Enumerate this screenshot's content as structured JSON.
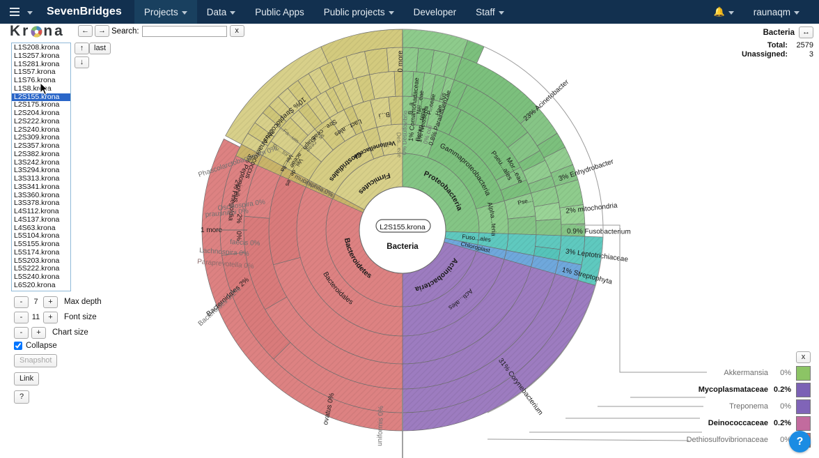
{
  "navbar": {
    "brand": "SevenBridges",
    "menu_icon": "hamburger-icon",
    "items": [
      {
        "label": "Projects",
        "caret": true,
        "active": true
      },
      {
        "label": "Data",
        "caret": true,
        "active": false
      },
      {
        "label": "Public Apps",
        "caret": false,
        "active": false
      },
      {
        "label": "Public projects",
        "caret": true,
        "active": false
      },
      {
        "label": "Developer",
        "caret": false,
        "active": false
      },
      {
        "label": "Staff",
        "caret": true,
        "active": false
      }
    ],
    "notifications_icon": "bell-icon",
    "user": "raunaqm"
  },
  "krona": {
    "logo_text_before": "Kr",
    "logo_text_after": "na",
    "back_label": "←",
    "forward_label": "→",
    "search_label": "Search:",
    "search_value": "",
    "search_placeholder": "",
    "search_clear_label": "x",
    "up_label": "↑",
    "down_label": "↓",
    "last_label": "last"
  },
  "file_list": {
    "selected": "L2S155.krona",
    "items": [
      "L1S208.krona",
      "L1S257.krona",
      "L1S281.krona",
      "L1S57.krona",
      "L1S76.krona",
      "L1S8.krona",
      "L2S155.krona",
      "L2S175.krona",
      "L2S204.krona",
      "L2S222.krona",
      "L2S240.krona",
      "L2S309.krona",
      "L2S357.krona",
      "L2S382.krona",
      "L3S242.krona",
      "L3S294.krona",
      "L3S313.krona",
      "L3S341.krona",
      "L3S360.krona",
      "L3S378.krona",
      "L4S112.krona",
      "L4S137.krona",
      "L4S63.krona",
      "L5S104.krona",
      "L5S155.krona",
      "L5S174.krona",
      "L5S203.krona",
      "L5S222.krona",
      "L5S240.krona",
      "L6S20.krona"
    ]
  },
  "controls": {
    "minus": "-",
    "plus": "+",
    "max_depth_value": "7",
    "max_depth_label": "Max depth",
    "font_size_value": "11",
    "font_size_label": "Font size",
    "chart_size_label": "Chart size",
    "collapse_label": "Collapse",
    "collapse_checked": true,
    "snapshot_label": "Snapshot",
    "link_label": "Link",
    "help_label": "?"
  },
  "info": {
    "title": "Bacteria",
    "resize_icon": "resize-horizontal-icon",
    "total_label": "Total:",
    "total_value": "2579",
    "unassigned_label": "Unassigned:",
    "unassigned_value": "3"
  },
  "key": {
    "close_label": "x",
    "items": [
      {
        "label": "Akkermansia",
        "pct": "0%",
        "color": "#8cc465",
        "bold": false
      },
      {
        "label": "Mycoplasmataceae",
        "pct": "0.2%",
        "color": "#7b61b5",
        "bold": true
      },
      {
        "label": "Treponema",
        "pct": "0%",
        "color": "#8064b8",
        "bold": false
      },
      {
        "label": "Deinococcaceae",
        "pct": "0.2%",
        "color": "#c26b9e",
        "bold": true
      },
      {
        "label": "Dethiosulfovibrionaceae",
        "pct": "0%",
        "color": "#db6f6f",
        "bold": false
      }
    ]
  },
  "help_bubble": {
    "label": "?"
  },
  "chart_data": {
    "type": "pie",
    "title": "Bacteria",
    "center_file_label": "L2S155.krona",
    "center_label": "Bacteria",
    "total": 2579,
    "unassigned": 3,
    "colors": {
      "firmicutes": "#d8d08a",
      "proteobacteria": "#84c585",
      "bacteroidetes": "#dd8282",
      "actinobacteria": "#9d7cc0",
      "fusobacteria": "#5fc9bf",
      "cyanobacteria": "#6fa8dc",
      "verrucomicrobia": "#c9b46a",
      "background": "#ffffff",
      "stroke": "#5b5b5b"
    },
    "slices": [
      {
        "label": "Firmicutes",
        "pct": "",
        "ring": 1,
        "color": "#d8d08a"
      },
      {
        "label": "Proteobacteria",
        "pct": "",
        "ring": 1,
        "color": "#84c585"
      },
      {
        "label": "Bacteroidetes",
        "pct": "",
        "ring": 1,
        "color": "#dd8282"
      },
      {
        "label": "Actinobacteria",
        "pct": "",
        "ring": 1,
        "color": "#9d7cc0"
      },
      {
        "label": "Clostridiales",
        "pct": "",
        "ring": 2,
        "color": "#d6cd84"
      },
      {
        "label": "Bacteroidales",
        "pct": "",
        "ring": 2,
        "color": "#dd8282"
      },
      {
        "label": "Gammaproteobacteria",
        "pct": "",
        "ring": 2,
        "color": "#7cc07d"
      },
      {
        "label": "Acti...ales",
        "pct": "",
        "ring": 2,
        "color": "#9d7cc0"
      }
    ],
    "annotations": [
      {
        "text": "0 more",
        "pct": ""
      },
      {
        "text": "1 more",
        "pct": ""
      },
      {
        "text": "Streptococcus",
        "pct": "10%"
      },
      {
        "text": "Anaerococcus",
        "pct": "3%"
      },
      {
        "text": "Peptoniphilus",
        "pct": "3%"
      },
      {
        "text": "Finegoldia",
        "pct": "2%"
      },
      {
        "text": "Phascolarctobacterium",
        "pct": "0%"
      },
      {
        "text": "Oscillospira",
        "pct": "0%"
      },
      {
        "text": "prausnitzii",
        "pct": "0%"
      },
      {
        "text": "faecis",
        "pct": "0%"
      },
      {
        "text": "Lachnospira",
        "pct": "0%"
      },
      {
        "text": "Paraprevotella",
        "pct": "0%"
      },
      {
        "text": "Bacteroidales",
        "pct": "2%"
      },
      {
        "text": "Bacteroides",
        "pct": "0.2%"
      },
      {
        "text": "ovatus",
        "pct": "0%"
      },
      {
        "text": "uniformis",
        "pct": "0%"
      },
      {
        "text": "Corynebacterium",
        "pct": "31%"
      },
      {
        "text": "Streptophyta",
        "pct": "1%"
      },
      {
        "text": "Leptotrichiaceae",
        "pct": "3%"
      },
      {
        "text": "Fusobacterium",
        "pct": "0.9%"
      },
      {
        "text": "mitochondria",
        "pct": "2%"
      },
      {
        "text": "Enhydrobacter",
        "pct": "3%"
      },
      {
        "text": "Acinetobacter",
        "pct": "23%"
      },
      {
        "text": "Parainfluenzae",
        "pct": "0.8%"
      },
      {
        "text": "Neisseria",
        "pct": "1%"
      },
      {
        "text": "Comamonadaceae",
        "pct": "1%"
      },
      {
        "text": "muciniphila",
        "pct": "0%"
      },
      {
        "text": "Akkermansia",
        "pct": ""
      },
      {
        "text": "Desulfovibrio",
        "pct": "0%"
      },
      {
        "text": "Veillonella",
        "pct": "2%"
      }
    ]
  }
}
